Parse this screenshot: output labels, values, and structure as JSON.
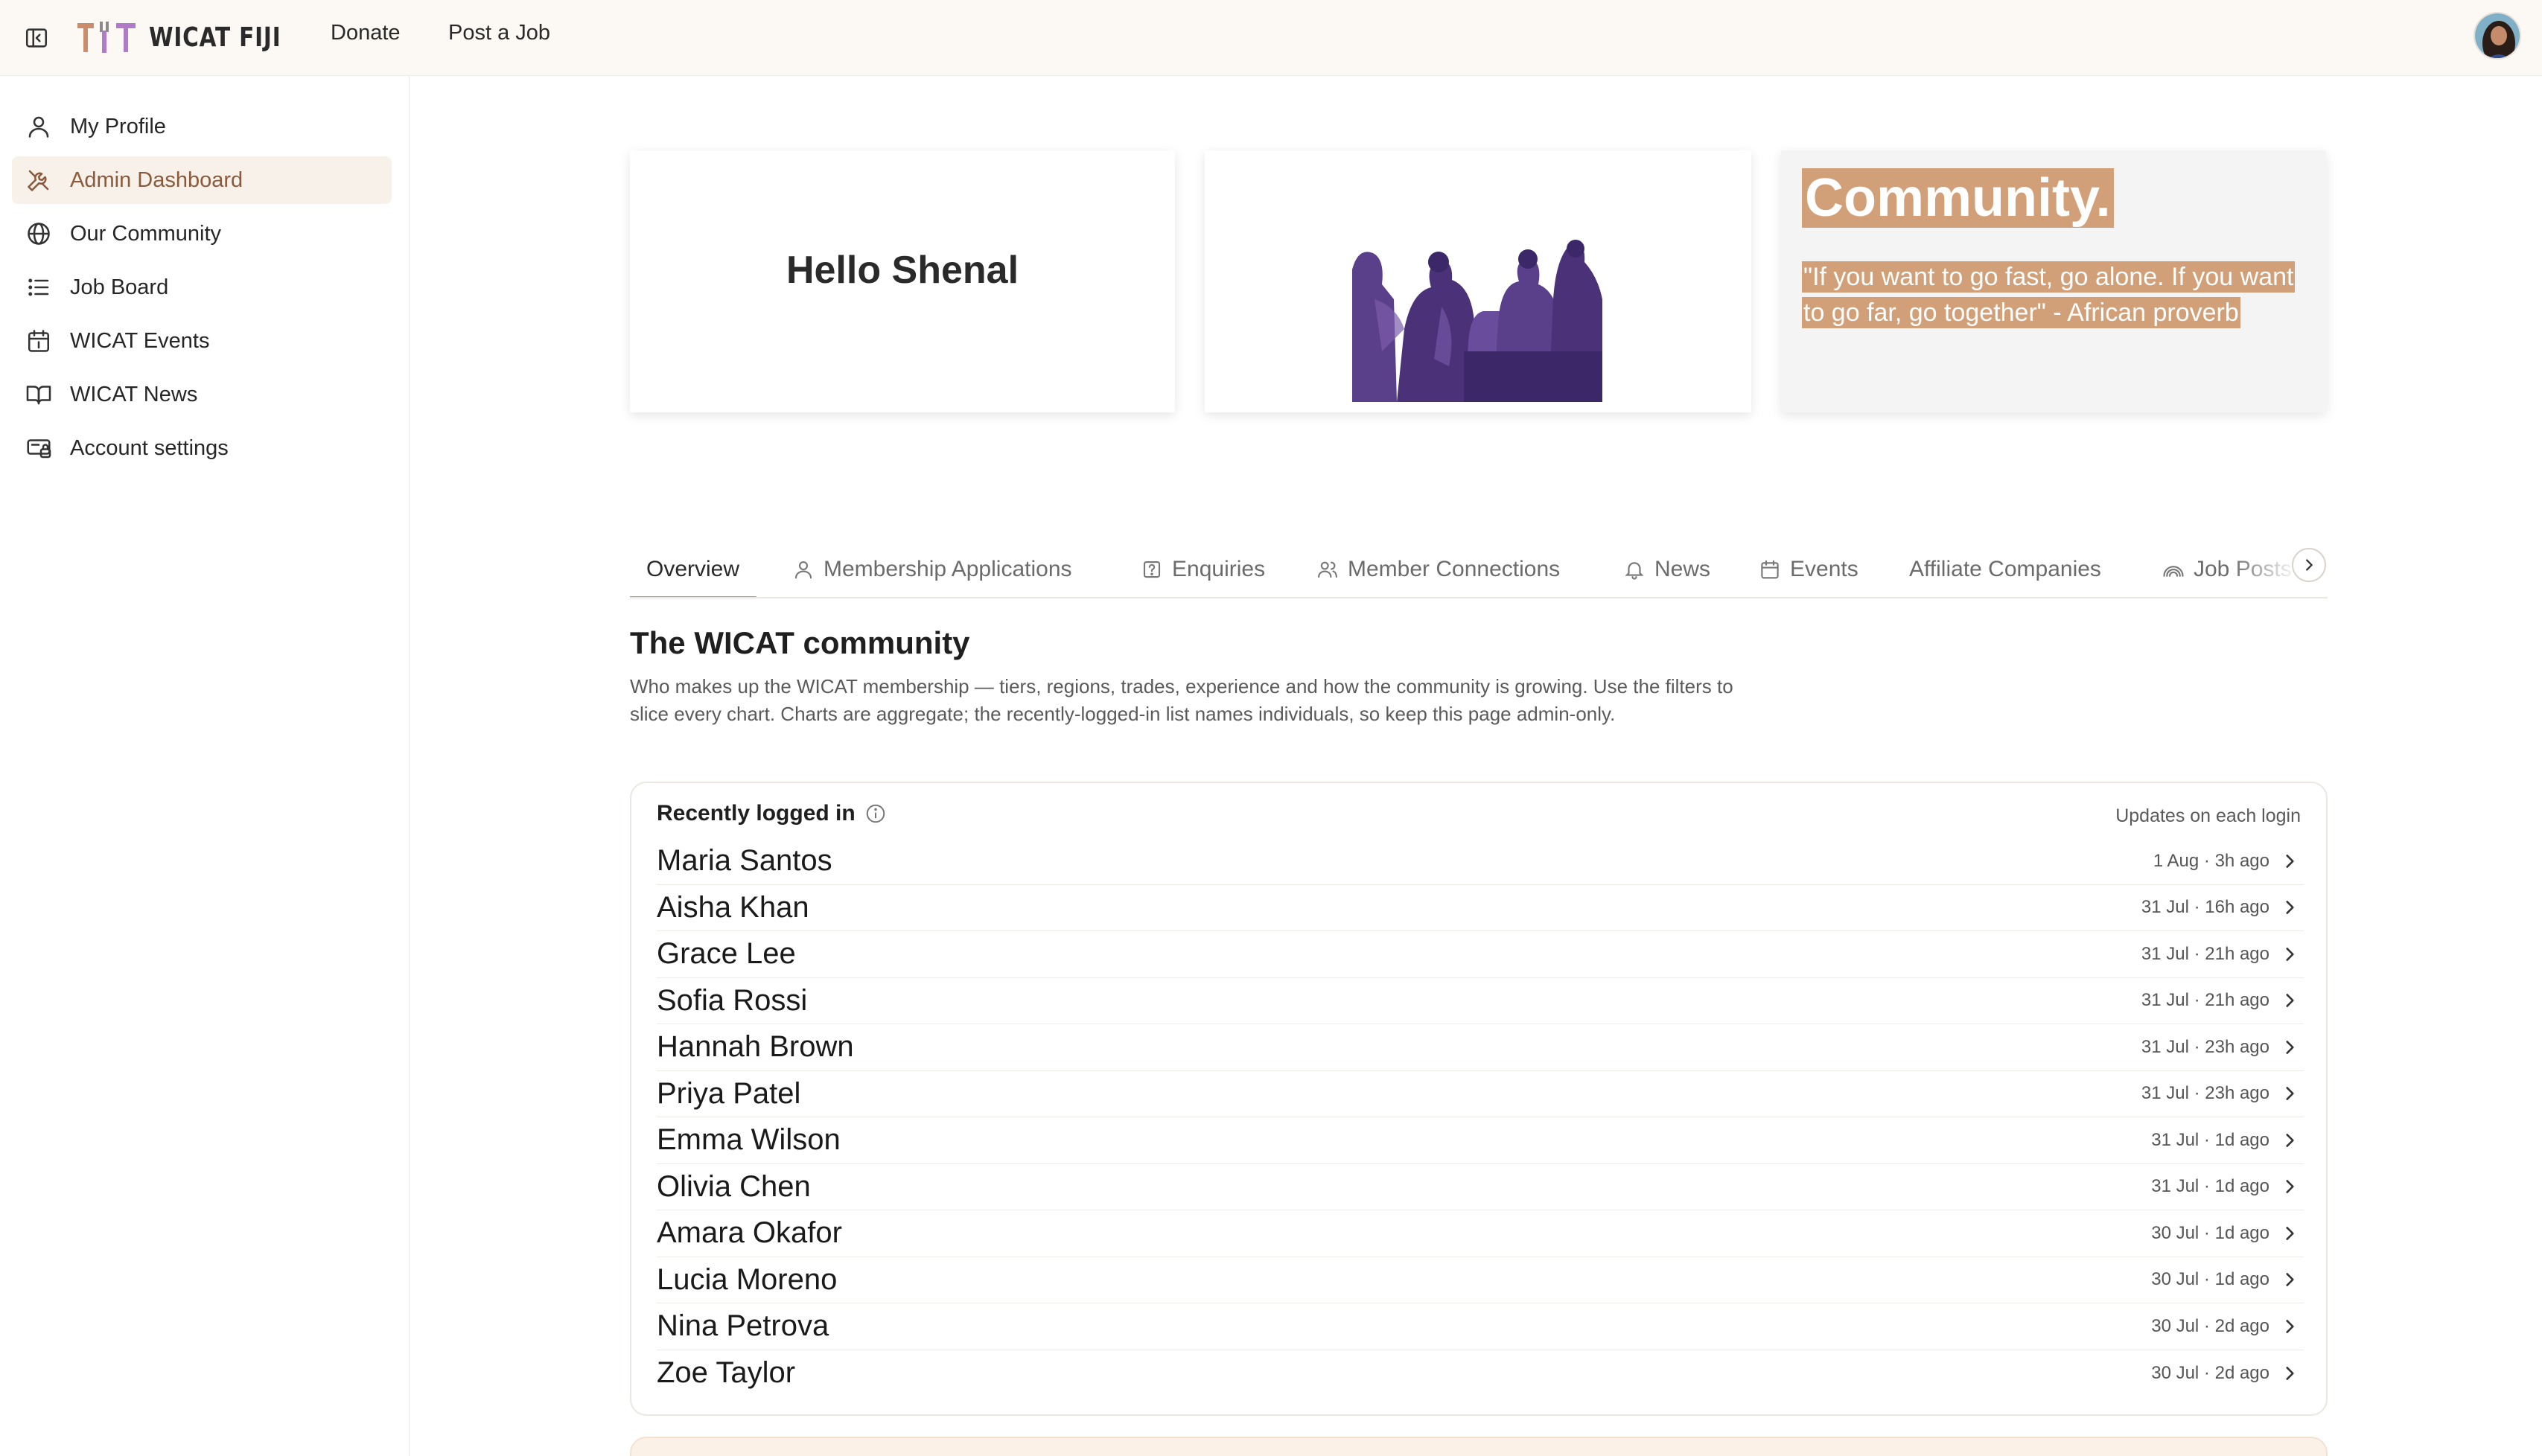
{
  "brand": {
    "name": "WICAT FIJI"
  },
  "topnav": {
    "donate": "Donate",
    "post_job": "Post a Job"
  },
  "sidebar": {
    "items": [
      {
        "label": "My Profile",
        "icon": "user-icon"
      },
      {
        "label": "Admin Dashboard",
        "icon": "tools-icon",
        "active": true
      },
      {
        "label": "Our Community",
        "icon": "globe-icon"
      },
      {
        "label": "Job Board",
        "icon": "list-icon"
      },
      {
        "label": "WICAT Events",
        "icon": "calendar-icon"
      },
      {
        "label": "WICAT News",
        "icon": "book-icon"
      },
      {
        "label": "Account settings",
        "icon": "settings-icon"
      }
    ]
  },
  "hero": {
    "greeting": "Hello Shenal",
    "quote_title": "Community.",
    "quote_text": "\"If you want to go fast, go alone. If you want to go far, go together\" - African proverb"
  },
  "tabs": [
    {
      "label": "Overview",
      "icon": "",
      "active": true
    },
    {
      "label": "Membership Applications",
      "icon": "user-icon"
    },
    {
      "label": "Enquiries",
      "icon": "question-icon"
    },
    {
      "label": "Member Connections",
      "icon": "users-icon"
    },
    {
      "label": "News",
      "icon": "bell-icon"
    },
    {
      "label": "Events",
      "icon": "calendar-icon"
    },
    {
      "label": "Affiliate Companies",
      "icon": ""
    },
    {
      "label": "Job Posts",
      "icon": "rss-icon"
    }
  ],
  "section": {
    "title": "The WICAT community",
    "description": "Who makes up the WICAT membership — tiers, regions, trades, experience and how the community is growing. Use the filters to slice every chart. Charts are aggregate; the recently-logged-in list names individuals, so keep this page admin-only."
  },
  "recent": {
    "title": "Recently logged in",
    "note": "Updates on each login",
    "rows": [
      {
        "name": "Maria Santos",
        "when": "1 Aug · 3h ago"
      },
      {
        "name": "Aisha Khan",
        "when": "31 Jul · 16h ago"
      },
      {
        "name": "Grace Lee",
        "when": "31 Jul · 21h ago"
      },
      {
        "name": "Sofia Rossi",
        "when": "31 Jul · 21h ago"
      },
      {
        "name": "Hannah Brown",
        "when": "31 Jul · 23h ago"
      },
      {
        "name": "Priya Patel",
        "when": "31 Jul · 23h ago"
      },
      {
        "name": "Emma Wilson",
        "when": "31 Jul · 1d ago"
      },
      {
        "name": "Olivia Chen",
        "when": "31 Jul · 1d ago"
      },
      {
        "name": "Amara Okafor",
        "when": "30 Jul · 1d ago"
      },
      {
        "name": "Lucia Moreno",
        "when": "30 Jul · 1d ago"
      },
      {
        "name": "Nina Petrova",
        "when": "30 Jul · 2d ago"
      },
      {
        "name": "Zoe Taylor",
        "when": "30 Jul · 2d ago"
      }
    ]
  },
  "colors": {
    "accent": "#c98d6b",
    "highlight": "#d2a078",
    "photo_tint": "#5a3f8a"
  }
}
